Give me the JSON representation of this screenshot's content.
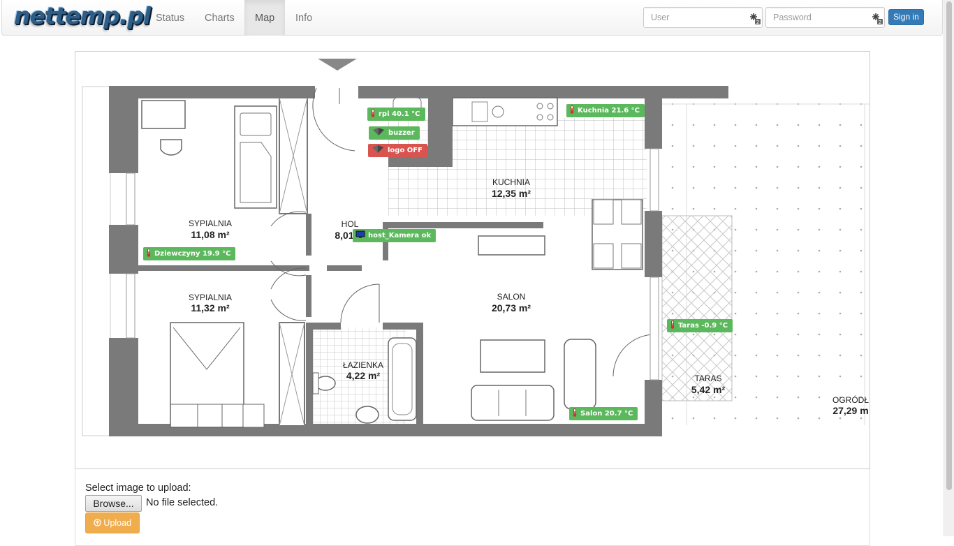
{
  "navbar": {
    "logo": "nettemp.pl",
    "tabs": [
      {
        "label": "Status",
        "active": false
      },
      {
        "label": "Charts",
        "active": false
      },
      {
        "label": "Map",
        "active": true
      },
      {
        "label": "Info",
        "active": false
      }
    ],
    "user_placeholder": "User",
    "password_placeholder": "Password",
    "signin_label": "Sign in",
    "field_icon": "key-icon"
  },
  "map": {
    "rooms": [
      {
        "name": "SYPIALNIA",
        "area": "11,08 m²"
      },
      {
        "name": "SYPIALNIA",
        "area": "11,32 m²"
      },
      {
        "name": "HOL",
        "area": "8,01"
      },
      {
        "name": "KUCHNIA",
        "area": "12,35 m²"
      },
      {
        "name": "SALON",
        "area": "20,73 m²"
      },
      {
        "name": "ŁAZIENKA",
        "area": "4,22 m²"
      },
      {
        "name": "TARAS",
        "area": "5,42 m²"
      },
      {
        "name": "OGRÓDŁ",
        "area": "27,29 m"
      }
    ],
    "sensors": [
      {
        "label": "rpi 40.1 °C",
        "icon": "thermometer-icon",
        "status": "ok"
      },
      {
        "label": "buzzer",
        "icon": "relay-icon",
        "status": "ok"
      },
      {
        "label": "logo OFF",
        "icon": "relay-icon",
        "status": "off"
      },
      {
        "label": "Kuchnia 21.6 °C",
        "icon": "thermometer-icon",
        "status": "ok"
      },
      {
        "label": "host_Kamera ok",
        "icon": "monitor-icon",
        "status": "ok"
      },
      {
        "label": "Dziewczyny 19.9 °C",
        "icon": "thermometer-icon",
        "status": "ok"
      },
      {
        "label": "Taras -0.9 °C",
        "icon": "thermometer-icon",
        "status": "ok"
      },
      {
        "label": "Salon 20.7 °C",
        "icon": "thermometer-icon",
        "status": "ok"
      }
    ]
  },
  "upload": {
    "label": "Select image to upload:",
    "browse_label": "Browse...",
    "no_file_text": "No file selected.",
    "upload_label": "Upload",
    "upload_icon": "circle-arrow-up-icon"
  },
  "colors": {
    "ok": "#5cb85c",
    "off": "#d9534f",
    "primary": "#337ab7",
    "warning": "#f0ad4e"
  }
}
